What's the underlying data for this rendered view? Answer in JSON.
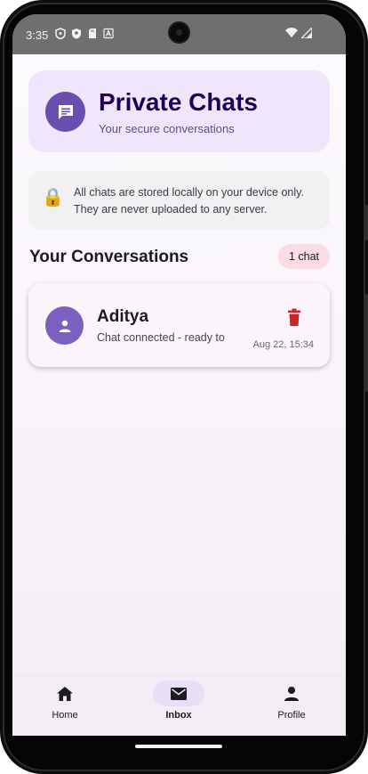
{
  "status_bar": {
    "time": "3:35",
    "left_icons": [
      "privacy-shield-icon",
      "vpn-key-icon",
      "sd-card-icon",
      "font-a-icon"
    ],
    "right_icons": [
      "wifi-icon",
      "cellular-signal-icon"
    ]
  },
  "header": {
    "icon": "chat-bubble-icon",
    "title": "Private Chats",
    "subtitle": "Your secure conversations"
  },
  "notice": {
    "icon": "lock-icon",
    "text": "All chats are stored locally on your device only. They are never uploaded to any server."
  },
  "conversations": {
    "title": "Your Conversations",
    "count_label": "1 chat",
    "items": [
      {
        "name": "Aditya",
        "preview": "Chat connected - ready to",
        "time": "Aug 22, 15:34",
        "avatar_icon": "person-icon",
        "action_icon": "trash-icon"
      }
    ]
  },
  "bottom_nav": {
    "items": [
      {
        "label": "Home",
        "icon": "home-icon",
        "active": false
      },
      {
        "label": "Inbox",
        "icon": "mail-icon",
        "active": true
      },
      {
        "label": "Profile",
        "icon": "person-icon",
        "active": false
      }
    ]
  },
  "colors": {
    "primary": "#6a4fb0",
    "header_bg": "#efe6fb",
    "title_text": "#21005d",
    "chip_bg": "#fadde3",
    "delete_red": "#c62828",
    "nav_active_bg": "#e8def8"
  }
}
